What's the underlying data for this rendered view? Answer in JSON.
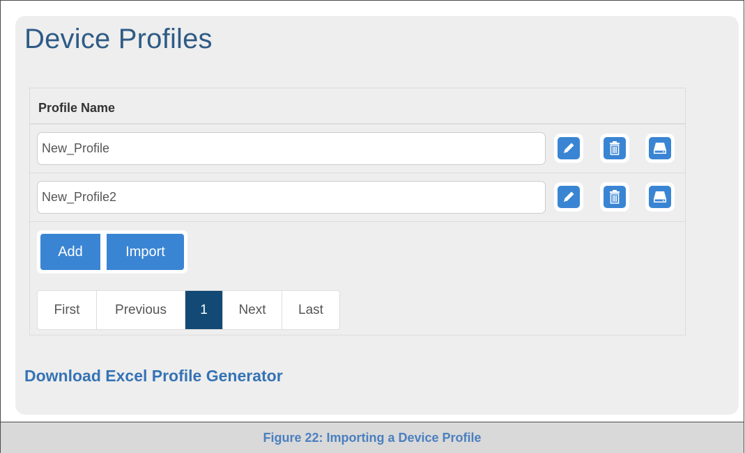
{
  "page": {
    "title": "Device Profiles",
    "download_link": "Download Excel Profile Generator"
  },
  "table": {
    "header": "Profile Name",
    "rows": [
      {
        "name": "New_Profile",
        "actions": [
          "pencil-icon",
          "trash-icon",
          "drive-icon"
        ]
      },
      {
        "name": "New_Profile2",
        "actions": [
          "pencil-icon",
          "trash-icon",
          "drive-icon"
        ]
      }
    ]
  },
  "actions": {
    "add_label": "Add",
    "import_label": "Import"
  },
  "pagination": {
    "first": "First",
    "previous": "Previous",
    "current": "1",
    "next": "Next",
    "last": "Last"
  },
  "caption": "Figure 22: Importing a Device Profile",
  "colors": {
    "accent": "#3a85d3",
    "current_page": "#134a75",
    "title": "#2e5b85",
    "link": "#3573b5",
    "caption": "#4a7fbf"
  }
}
